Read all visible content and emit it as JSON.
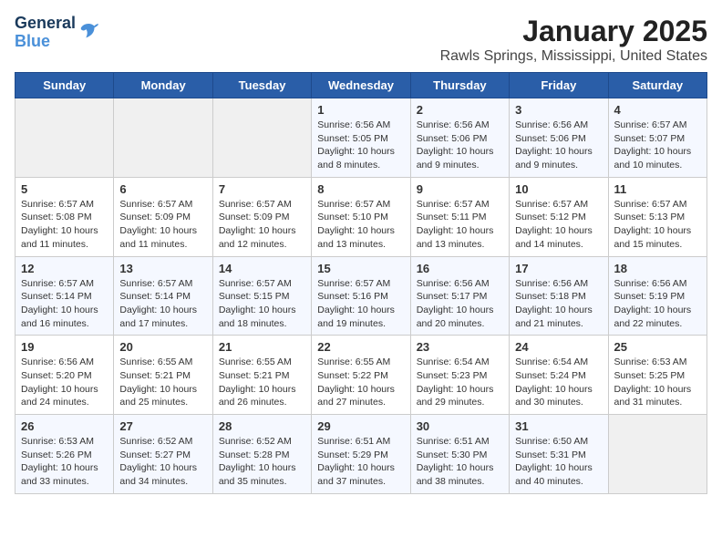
{
  "logo": {
    "line1": "General",
    "line2": "Blue"
  },
  "title": "January 2025",
  "subtitle": "Rawls Springs, Mississippi, United States",
  "weekdays": [
    "Sunday",
    "Monday",
    "Tuesday",
    "Wednesday",
    "Thursday",
    "Friday",
    "Saturday"
  ],
  "weeks": [
    [
      {
        "day": "",
        "info": ""
      },
      {
        "day": "",
        "info": ""
      },
      {
        "day": "",
        "info": ""
      },
      {
        "day": "1",
        "info": "Sunrise: 6:56 AM\nSunset: 5:05 PM\nDaylight: 10 hours\nand 8 minutes."
      },
      {
        "day": "2",
        "info": "Sunrise: 6:56 AM\nSunset: 5:06 PM\nDaylight: 10 hours\nand 9 minutes."
      },
      {
        "day": "3",
        "info": "Sunrise: 6:56 AM\nSunset: 5:06 PM\nDaylight: 10 hours\nand 9 minutes."
      },
      {
        "day": "4",
        "info": "Sunrise: 6:57 AM\nSunset: 5:07 PM\nDaylight: 10 hours\nand 10 minutes."
      }
    ],
    [
      {
        "day": "5",
        "info": "Sunrise: 6:57 AM\nSunset: 5:08 PM\nDaylight: 10 hours\nand 11 minutes."
      },
      {
        "day": "6",
        "info": "Sunrise: 6:57 AM\nSunset: 5:09 PM\nDaylight: 10 hours\nand 11 minutes."
      },
      {
        "day": "7",
        "info": "Sunrise: 6:57 AM\nSunset: 5:09 PM\nDaylight: 10 hours\nand 12 minutes."
      },
      {
        "day": "8",
        "info": "Sunrise: 6:57 AM\nSunset: 5:10 PM\nDaylight: 10 hours\nand 13 minutes."
      },
      {
        "day": "9",
        "info": "Sunrise: 6:57 AM\nSunset: 5:11 PM\nDaylight: 10 hours\nand 13 minutes."
      },
      {
        "day": "10",
        "info": "Sunrise: 6:57 AM\nSunset: 5:12 PM\nDaylight: 10 hours\nand 14 minutes."
      },
      {
        "day": "11",
        "info": "Sunrise: 6:57 AM\nSunset: 5:13 PM\nDaylight: 10 hours\nand 15 minutes."
      }
    ],
    [
      {
        "day": "12",
        "info": "Sunrise: 6:57 AM\nSunset: 5:14 PM\nDaylight: 10 hours\nand 16 minutes."
      },
      {
        "day": "13",
        "info": "Sunrise: 6:57 AM\nSunset: 5:14 PM\nDaylight: 10 hours\nand 17 minutes."
      },
      {
        "day": "14",
        "info": "Sunrise: 6:57 AM\nSunset: 5:15 PM\nDaylight: 10 hours\nand 18 minutes."
      },
      {
        "day": "15",
        "info": "Sunrise: 6:57 AM\nSunset: 5:16 PM\nDaylight: 10 hours\nand 19 minutes."
      },
      {
        "day": "16",
        "info": "Sunrise: 6:56 AM\nSunset: 5:17 PM\nDaylight: 10 hours\nand 20 minutes."
      },
      {
        "day": "17",
        "info": "Sunrise: 6:56 AM\nSunset: 5:18 PM\nDaylight: 10 hours\nand 21 minutes."
      },
      {
        "day": "18",
        "info": "Sunrise: 6:56 AM\nSunset: 5:19 PM\nDaylight: 10 hours\nand 22 minutes."
      }
    ],
    [
      {
        "day": "19",
        "info": "Sunrise: 6:56 AM\nSunset: 5:20 PM\nDaylight: 10 hours\nand 24 minutes."
      },
      {
        "day": "20",
        "info": "Sunrise: 6:55 AM\nSunset: 5:21 PM\nDaylight: 10 hours\nand 25 minutes."
      },
      {
        "day": "21",
        "info": "Sunrise: 6:55 AM\nSunset: 5:21 PM\nDaylight: 10 hours\nand 26 minutes."
      },
      {
        "day": "22",
        "info": "Sunrise: 6:55 AM\nSunset: 5:22 PM\nDaylight: 10 hours\nand 27 minutes."
      },
      {
        "day": "23",
        "info": "Sunrise: 6:54 AM\nSunset: 5:23 PM\nDaylight: 10 hours\nand 29 minutes."
      },
      {
        "day": "24",
        "info": "Sunrise: 6:54 AM\nSunset: 5:24 PM\nDaylight: 10 hours\nand 30 minutes."
      },
      {
        "day": "25",
        "info": "Sunrise: 6:53 AM\nSunset: 5:25 PM\nDaylight: 10 hours\nand 31 minutes."
      }
    ],
    [
      {
        "day": "26",
        "info": "Sunrise: 6:53 AM\nSunset: 5:26 PM\nDaylight: 10 hours\nand 33 minutes."
      },
      {
        "day": "27",
        "info": "Sunrise: 6:52 AM\nSunset: 5:27 PM\nDaylight: 10 hours\nand 34 minutes."
      },
      {
        "day": "28",
        "info": "Sunrise: 6:52 AM\nSunset: 5:28 PM\nDaylight: 10 hours\nand 35 minutes."
      },
      {
        "day": "29",
        "info": "Sunrise: 6:51 AM\nSunset: 5:29 PM\nDaylight: 10 hours\nand 37 minutes."
      },
      {
        "day": "30",
        "info": "Sunrise: 6:51 AM\nSunset: 5:30 PM\nDaylight: 10 hours\nand 38 minutes."
      },
      {
        "day": "31",
        "info": "Sunrise: 6:50 AM\nSunset: 5:31 PM\nDaylight: 10 hours\nand 40 minutes."
      },
      {
        "day": "",
        "info": ""
      }
    ]
  ]
}
